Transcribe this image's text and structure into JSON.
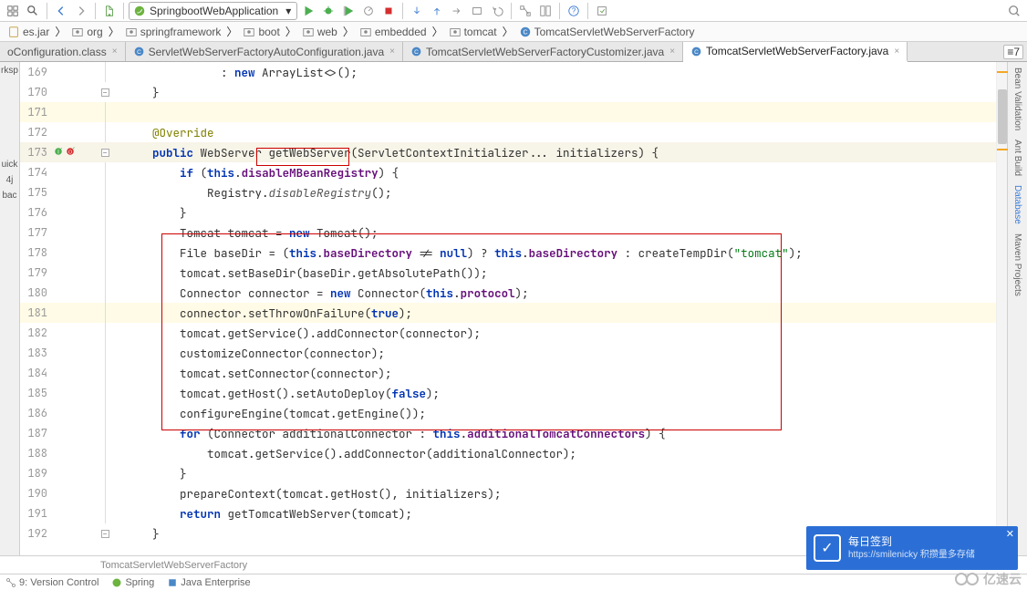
{
  "toolbar": {
    "run_config": "SpringbootWebApplication"
  },
  "breadcrumb": {
    "items": [
      "es.jar",
      "org",
      "springframework",
      "boot",
      "web",
      "embedded",
      "tomcat",
      "TomcatServletWebServerFactory"
    ]
  },
  "tabs": {
    "items": [
      {
        "label": "oConfiguration.class",
        "type": "class",
        "active": false
      },
      {
        "label": "ServletWebServerFactoryAutoConfiguration.java",
        "type": "java",
        "active": false
      },
      {
        "label": "TomcatServletWebServerFactoryCustomizer.java",
        "type": "java",
        "active": false
      },
      {
        "label": "TomcatServletWebServerFactory.java",
        "type": "java",
        "active": true
      }
    ],
    "right_badge": "≡7"
  },
  "left_panel": {
    "items": [
      "rksp",
      "uick",
      "4j",
      "bac"
    ]
  },
  "right_panel": {
    "items": [
      "Bean Validation",
      "Ant Build",
      "Database",
      "Maven Projects"
    ]
  },
  "code": {
    "lines": [
      {
        "n": 169,
        "html": "            : <span class='kw'>new</span> ArrayList<>();"
      },
      {
        "n": 170,
        "fold": "end",
        "html": "  }"
      },
      {
        "n": 171,
        "hl": true,
        "html": ""
      },
      {
        "n": 172,
        "html": "  <span class='ann'>@Override</span>"
      },
      {
        "n": 173,
        "cur": true,
        "icons": [
          "impl",
          "override"
        ],
        "fold": "start",
        "html": "  <span class='kw'>public</span> WebServer getWebServer(ServletContextInitializer... initializers) {"
      },
      {
        "n": 174,
        "html": "      <span class='kw'>if</span> (<span class='kw'>this</span>.<span class='fld'>disableMBeanRegistry</span>) {"
      },
      {
        "n": 175,
        "html": "          Registry.<span class='mtd'>disableRegistry</span>();"
      },
      {
        "n": 176,
        "html": "      }"
      },
      {
        "n": 177,
        "html": "      Tomcat tomcat = <span class='kw'>new</span> Tomcat();"
      },
      {
        "n": 178,
        "html": "      File baseDir = (<span class='kw'>this</span>.<span class='fld'>baseDirectory</span> != <span class='kw'>null</span>) ? <span class='kw'>this</span>.<span class='fld'>baseDirectory</span> : createTempDir(<span class='str'>\"tomcat\"</span>);"
      },
      {
        "n": 179,
        "html": "      tomcat.setBaseDir(baseDir.getAbsolutePath());"
      },
      {
        "n": 180,
        "html": "      Connector connector = <span class='kw'>new</span> Connector(<span class='kw'>this</span>.<span class='fld'>protocol</span>);"
      },
      {
        "n": 181,
        "hl": true,
        "html": "      connector.setThrowOnFailure(<span class='kw'>true</span>);"
      },
      {
        "n": 182,
        "html": "      tomcat.getService().addConnector(connector);"
      },
      {
        "n": 183,
        "html": "      customizeConnector(connector);"
      },
      {
        "n": 184,
        "html": "      tomcat.setConnector(connector);"
      },
      {
        "n": 185,
        "html": "      tomcat.getHost().setAutoDeploy(<span class='kw'>false</span>);"
      },
      {
        "n": 186,
        "html": "      configureEngine(tomcat.getEngine());"
      },
      {
        "n": 187,
        "html": "      <span class='kw'>for</span> (Connector additionalConnector : <span class='kw'>this</span>.<span class='fld'>additionalTomcatConnectors</span>) {"
      },
      {
        "n": 188,
        "html": "          tomcat.getService().addConnector(additionalConnector);"
      },
      {
        "n": 189,
        "html": "      }"
      },
      {
        "n": 190,
        "html": "      prepareContext(tomcat.getHost(), initializers);"
      },
      {
        "n": 191,
        "html": "      <span class='kw'>return</span> getTomcatWebServer(tomcat);"
      },
      {
        "n": 192,
        "fold": "end",
        "html": "  }"
      }
    ]
  },
  "breadcrumb_bottom": "TomcatServletWebServerFactory",
  "statusbar": {
    "items": [
      "9: Version Control",
      "Spring",
      "Java Enterprise"
    ]
  },
  "toast": {
    "title": "每日签到",
    "subtitle": "积攒量多存储",
    "url": "https://smilenicky"
  },
  "watermark": "亿速云"
}
